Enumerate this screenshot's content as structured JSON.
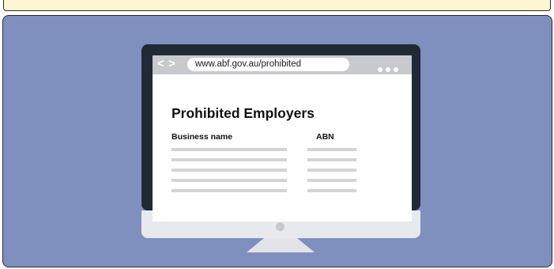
{
  "browser": {
    "back_glyph": "<",
    "forward_glyph": ">",
    "url": "www.abf.gov.au/prohibited"
  },
  "page": {
    "title": "Prohibited Employers",
    "table": {
      "columns": [
        "Business name",
        "ABN"
      ],
      "rows": 5
    }
  },
  "colors": {
    "panel_bg": "#7f90bf",
    "top_strip_bg": "#fdf6d3",
    "monitor_bezel": "#1f2a35",
    "browser_bar": "#c8c9ce",
    "placeholder_line": "#d3d4da"
  }
}
